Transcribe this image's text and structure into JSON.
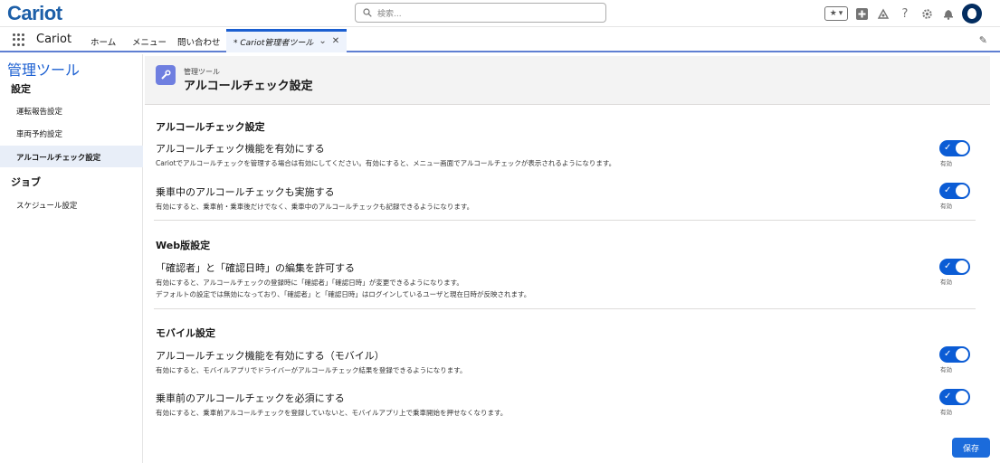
{
  "header": {
    "logo": "Cariot",
    "search_placeholder": "検索...",
    "favorites_icon": "star-icon",
    "icons": [
      "add-icon",
      "trailhead-icon",
      "help-icon",
      "setup-gear-icon",
      "notification-bell-icon",
      "avatar-icon"
    ]
  },
  "nav": {
    "app_name": "Cariot",
    "items": [
      "ホーム",
      "メニュー",
      "問い合わせ"
    ],
    "active_tab": "* Cariot管理者ツール"
  },
  "sidebar": {
    "title": "管理ツール",
    "sections": [
      {
        "label": "設定",
        "items": [
          "運転報告設定",
          "車両予約設定",
          "アルコールチェック設定"
        ]
      },
      {
        "label": "ジョブ",
        "items": [
          "スケジュール設定"
        ]
      }
    ],
    "active_item": "アルコールチェック設定"
  },
  "page": {
    "subtitle": "管理ツール",
    "title": "アルコールチェック設定"
  },
  "sections": [
    {
      "title": "アルコールチェック設定",
      "settings": [
        {
          "label": "アルコールチェック機能を有効にする",
          "desc": "Cariotでアルコールチェックを管理する場合は有効にしてください。有効にすると、メニュー画面でアルコールチェックが表示されるようになります。",
          "enabled": true,
          "status": "有効"
        },
        {
          "label": "乗車中のアルコールチェックも実施する",
          "desc": "有効にすると、乗車前・乗車後だけでなく、乗車中のアルコールチェックも記録できるようになります。",
          "enabled": true,
          "status": "有効"
        }
      ]
    },
    {
      "title": "Web版設定",
      "settings": [
        {
          "label": "「確認者」と「確認日時」の編集を許可する",
          "desc": "有効にすると、アルコールチェックの登録時に「確認者」「確認日時」が変更できるようになります。",
          "desc2": "デフォルトの設定では無効になっており、「確認者」と「確認日時」はログインしているユーザと現在日時が反映されます。",
          "enabled": true,
          "status": "有効"
        }
      ]
    },
    {
      "title": "モバイル設定",
      "settings": [
        {
          "label": "アルコールチェック機能を有効にする（モバイル）",
          "desc": "有効にすると、モバイルアプリでドライバーがアルコールチェック結果を登録できるようになります。",
          "enabled": true,
          "status": "有効"
        },
        {
          "label": "乗車前のアルコールチェックを必須にする",
          "desc": "有効にすると、乗車前アルコールチェックを登録していないと、モバイルアプリ上で乗車開始を押せなくなります。",
          "enabled": true,
          "status": "有効"
        }
      ]
    }
  ],
  "save_label": "保存",
  "colors": {
    "brand": "#1d5fa8",
    "toggle_on": "#0b5cd5",
    "accent": "#1b5fd1"
  }
}
